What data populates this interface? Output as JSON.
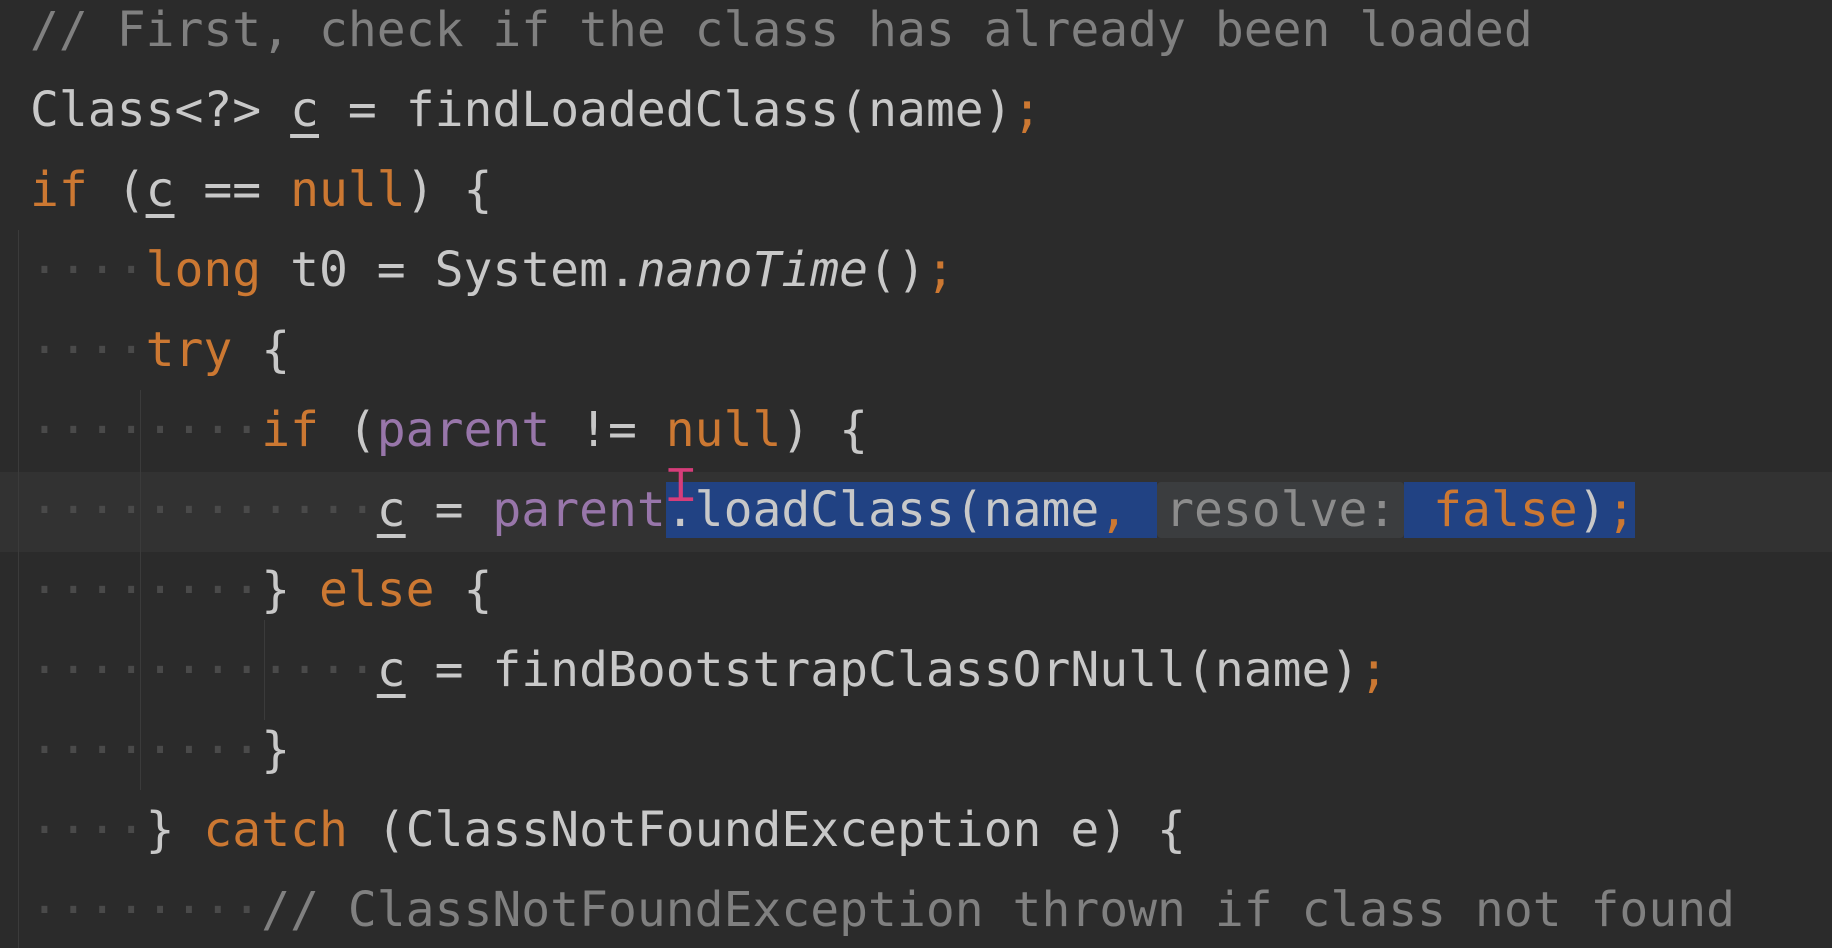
{
  "editor": {
    "language": "java",
    "lines": [
      [
        {
          "t": "// First, check if the class has already been loaded",
          "c": "cm"
        }
      ],
      [
        {
          "t": "Class<?> ",
          "c": "plain"
        },
        {
          "t": "c",
          "c": "plain uline"
        },
        {
          "t": " = findLoadedClass(name)",
          "c": "plain"
        },
        {
          "t": ";",
          "c": "kw"
        }
      ],
      [
        {
          "t": "if",
          "c": "kw"
        },
        {
          "t": " (",
          "c": "plain"
        },
        {
          "t": "c",
          "c": "plain uline"
        },
        {
          "t": " == ",
          "c": "plain"
        },
        {
          "t": "null",
          "c": "kw"
        },
        {
          "t": ") {",
          "c": "plain"
        }
      ],
      [
        {
          "t": "····",
          "c": "dots"
        },
        {
          "t": "long",
          "c": "kw"
        },
        {
          "t": " t0 = System.",
          "c": "plain"
        },
        {
          "t": "nanoTime",
          "c": "plain ital"
        },
        {
          "t": "()",
          "c": "plain"
        },
        {
          "t": ";",
          "c": "kw"
        }
      ],
      [
        {
          "t": "····",
          "c": "dots"
        },
        {
          "t": "try",
          "c": "kw"
        },
        {
          "t": " {",
          "c": "plain"
        }
      ],
      [
        {
          "t": "········",
          "c": "dots"
        },
        {
          "t": "if",
          "c": "kw"
        },
        {
          "t": " (",
          "c": "plain"
        },
        {
          "t": "parent",
          "c": "fld"
        },
        {
          "t": " != ",
          "c": "plain"
        },
        {
          "t": "null",
          "c": "kw"
        },
        {
          "t": ") {",
          "c": "plain"
        }
      ],
      [
        {
          "t": "············",
          "c": "dots"
        },
        {
          "t": "c",
          "c": "plain uline"
        },
        {
          "t": " = ",
          "c": "plain"
        },
        {
          "t": "parent",
          "c": "fld"
        },
        {
          "caret": true
        },
        {
          "t": ".loadClass(name",
          "c": "plain sel"
        },
        {
          "t": ", ",
          "c": "kw sel"
        },
        {
          "t": "resolve:",
          "c": "hint"
        },
        {
          "t": " ",
          "c": "plain sel"
        },
        {
          "t": "false",
          "c": "kw sel"
        },
        {
          "t": ")",
          "c": "plain sel"
        },
        {
          "t": ";",
          "c": "kw sel"
        }
      ],
      [
        {
          "t": "········",
          "c": "dots"
        },
        {
          "t": "} ",
          "c": "plain"
        },
        {
          "t": "else",
          "c": "kw"
        },
        {
          "t": " {",
          "c": "plain"
        }
      ],
      [
        {
          "t": "············",
          "c": "dots"
        },
        {
          "t": "c",
          "c": "plain uline"
        },
        {
          "t": " = findBootstrapClassOrNull(name)",
          "c": "plain"
        },
        {
          "t": ";",
          "c": "kw"
        }
      ],
      [
        {
          "t": "········",
          "c": "dots"
        },
        {
          "t": "}",
          "c": "plain"
        }
      ],
      [
        {
          "t": "····",
          "c": "dots"
        },
        {
          "t": "} ",
          "c": "plain"
        },
        {
          "t": "catch",
          "c": "kw"
        },
        {
          "t": " (ClassNotFoundException e) {",
          "c": "plain"
        }
      ],
      [
        {
          "t": "········",
          "c": "dots"
        },
        {
          "t": "// ClassNotFoundException thrown if class not found",
          "c": "cm"
        }
      ]
    ]
  }
}
